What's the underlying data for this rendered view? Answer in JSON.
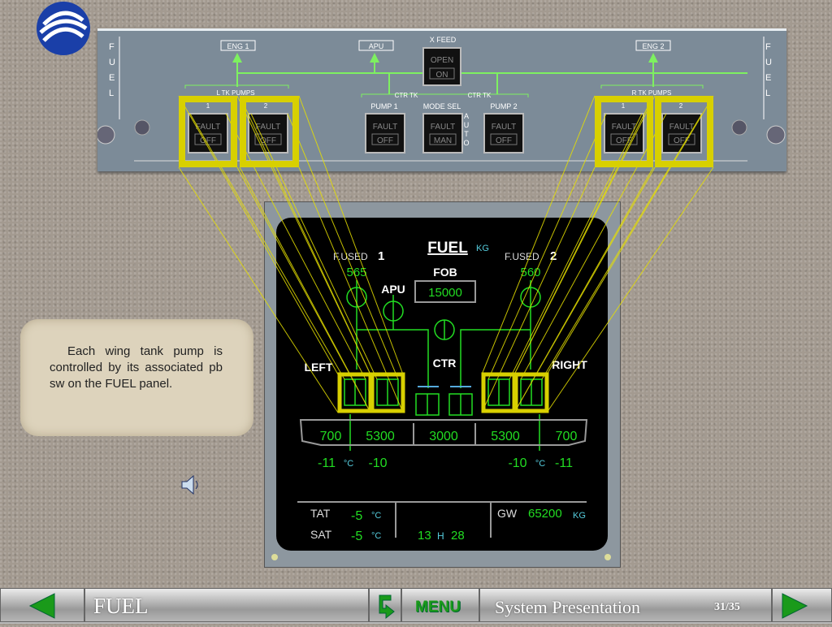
{
  "panel": {
    "side_label": "FUEL",
    "eng1": "ENG 1",
    "apu": "APU",
    "eng2": "ENG 2",
    "xfeed": "X FEED",
    "xfeed_open": "OPEN",
    "xfeed_on": "ON",
    "l_tk_pumps": "L TK PUMPS",
    "r_tk_pumps": "R TK PUMPS",
    "ctr_tk": "CTR TK",
    "pump1": "PUMP 1",
    "mode_sel": "MODE SEL",
    "pump2": "PUMP 2",
    "auto": "AUTO",
    "num1": "1",
    "num2": "2",
    "fault": "FAULT",
    "off": "OFF",
    "man": "MAN"
  },
  "ecam": {
    "title": "FUEL",
    "unit_kg": "KG",
    "fused1": "F.USED",
    "fused1_num": "1",
    "fused1_val": "565",
    "fused2": "F.USED",
    "fused2_num": "2",
    "fused2_val": "560",
    "fob": "FOB",
    "fob_val": "15000",
    "apu": "APU",
    "ctr": "CTR",
    "left": "LEFT",
    "right": "RIGHT",
    "tanks": [
      "700",
      "5300",
      "3000",
      "5300",
      "700"
    ],
    "temp_l1": "-11",
    "temp_l2": "-10",
    "temp_r1": "-10",
    "temp_r2": "-11",
    "deg_c": "°C",
    "tat": "TAT",
    "tat_val": "-5",
    "sat": "SAT",
    "sat_val": "-5",
    "time_h": "13",
    "time_sep": "H",
    "time_m": "28",
    "gw": "GW",
    "gw_val": "65200"
  },
  "note": "Each wing tank pump is controlled by its associated pb sw on the FUEL panel.",
  "nav": {
    "section": "FUEL",
    "menu": "MENU",
    "title": "System Presentation",
    "page": "31/35"
  },
  "colors": {
    "green": "#22dd22",
    "cyan": "#55ccdd",
    "highlight": "#e6e000"
  }
}
